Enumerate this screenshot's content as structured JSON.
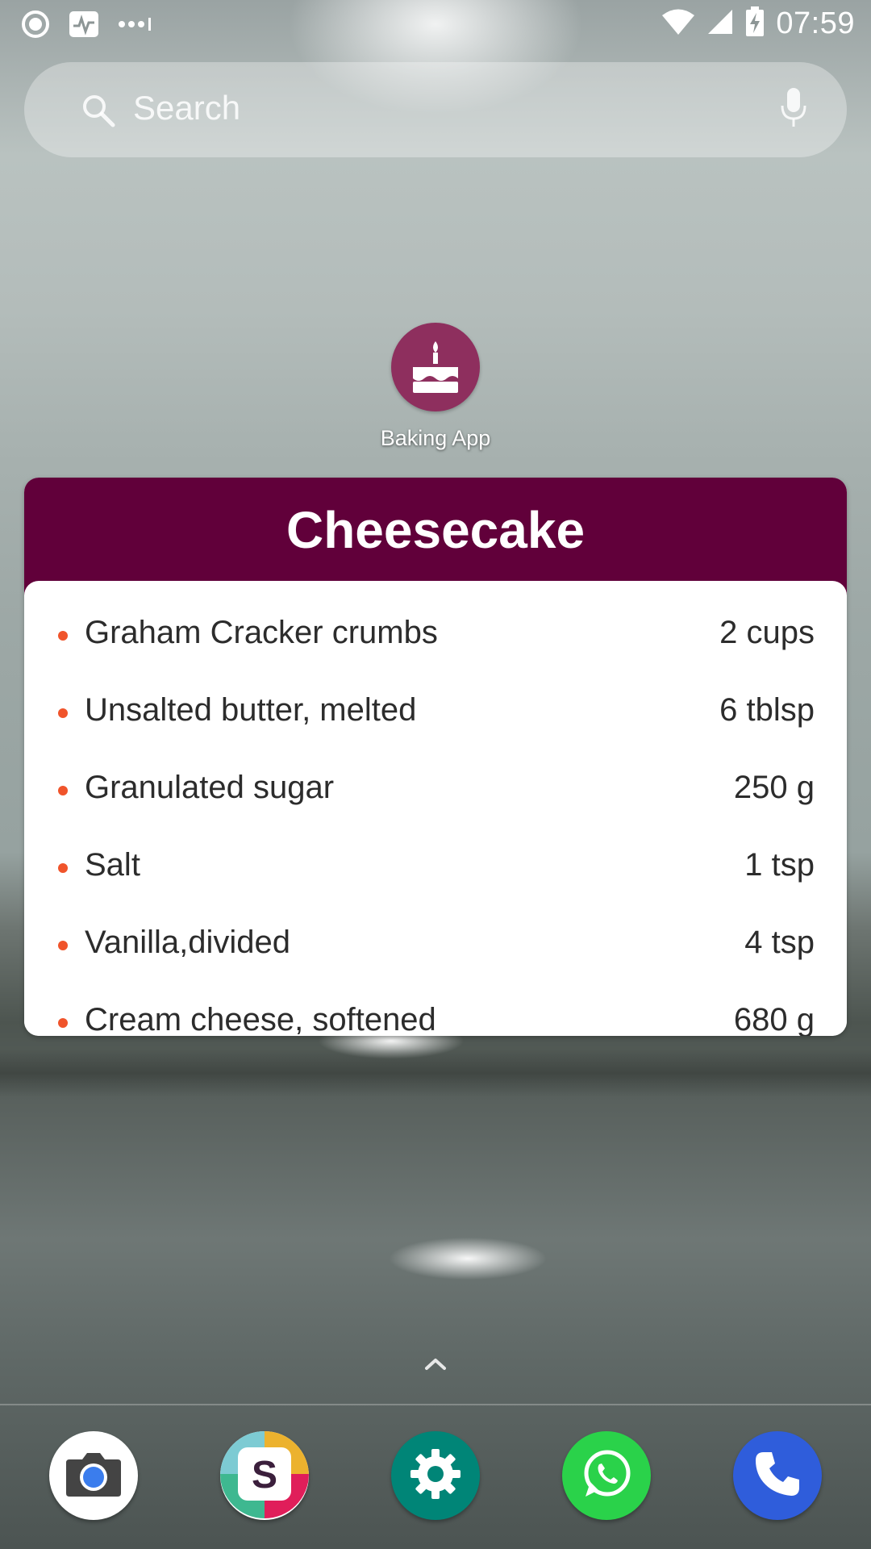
{
  "status_bar": {
    "time": "07:59"
  },
  "search": {
    "placeholder": "Search"
  },
  "app": {
    "label": "Baking App",
    "color": "#8e2f5e"
  },
  "widget": {
    "title": "Cheesecake",
    "header_color": "#61003a",
    "bullet_color": "#f0542b",
    "ingredients": [
      {
        "name": "Graham Cracker crumbs",
        "qty": "2 cups"
      },
      {
        "name": "Unsalted butter, melted",
        "qty": "6 tblsp"
      },
      {
        "name": "Granulated sugar",
        "qty": "250 g"
      },
      {
        "name": "Salt",
        "qty": "1 tsp"
      },
      {
        "name": "Vanilla,divided",
        "qty": "4 tsp"
      },
      {
        "name": "Cream cheese, softened",
        "qty": "680 g"
      }
    ]
  },
  "dock": {
    "apps": [
      {
        "icon": "camera-icon"
      },
      {
        "icon": "slack-icon",
        "letter": "S"
      },
      {
        "icon": "settings-icon"
      },
      {
        "icon": "whatsapp-icon"
      },
      {
        "icon": "phone-icon"
      }
    ]
  }
}
